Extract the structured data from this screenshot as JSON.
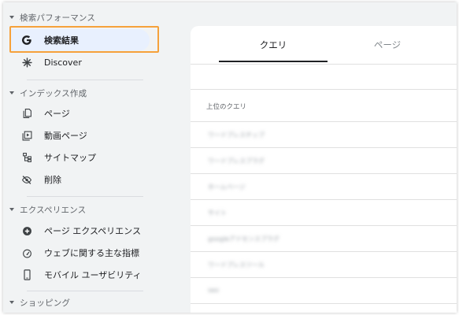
{
  "sidebar": {
    "sections": [
      {
        "title": "検索パフォーマンス"
      },
      {
        "title": "インデックス作成"
      },
      {
        "title": "エクスペリエンス"
      },
      {
        "title": "ショッピング"
      }
    ],
    "items": [
      {
        "label": "検索結果",
        "icon": "google-g-icon"
      },
      {
        "label": "Discover",
        "icon": "asterisk-icon"
      },
      {
        "label": "ページ",
        "icon": "pages-icon"
      },
      {
        "label": "動画ページ",
        "icon": "video-page-icon"
      },
      {
        "label": "サイトマップ",
        "icon": "sitemap-icon"
      },
      {
        "label": "削除",
        "icon": "eye-off-icon"
      },
      {
        "label": "ページ エクスペリエンス",
        "icon": "plus-circle-icon"
      },
      {
        "label": "ウェブに関する主な指標",
        "icon": "gauge-icon"
      },
      {
        "label": "モバイル ユーザビリティ",
        "icon": "phone-icon"
      }
    ],
    "highlight_color": "#f6a13a"
  },
  "main": {
    "tabs": [
      {
        "label": "クエリ",
        "selected": true
      },
      {
        "label": "ページ",
        "selected": false
      }
    ],
    "table": {
      "header": "上位のクエリ",
      "rows": [
        "ワードプレスチップ",
        "ワードプレスプラグ",
        "ホームページ",
        "サイト",
        "googleアドセンスプラグ",
        "ワードプレスツール",
        "seo"
      ]
    }
  }
}
